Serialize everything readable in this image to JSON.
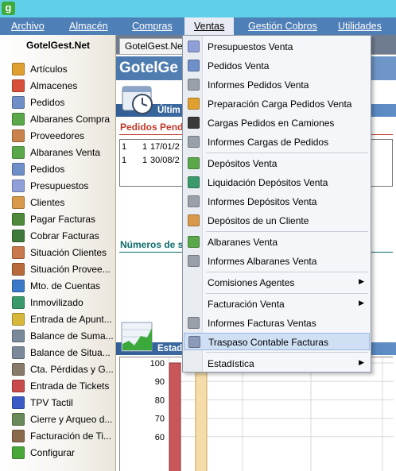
{
  "app": {
    "icon_letter": "g"
  },
  "menubar": {
    "items": [
      {
        "label": "Archivo"
      },
      {
        "label": "Almacén"
      },
      {
        "label": "Compras"
      },
      {
        "label": "Ventas"
      },
      {
        "label": "Gestión Cobros"
      },
      {
        "label": "Utilidades"
      }
    ]
  },
  "sidebar": {
    "title": "GotelGest.Net",
    "items": [
      {
        "label": "Artículos",
        "icon": "box-icon",
        "color": "#e0a030"
      },
      {
        "label": "Almacenes",
        "icon": "warehouse-icon",
        "color": "#d8503a"
      },
      {
        "label": "Pedidos",
        "icon": "document-icon",
        "color": "#6f8fc8"
      },
      {
        "label": "Albaranes Compra",
        "icon": "document-green-icon",
        "color": "#5aa84a"
      },
      {
        "label": "Proveedores",
        "icon": "person-icon",
        "color": "#c9824a"
      },
      {
        "label": "Albaranes Venta",
        "icon": "document-green-icon",
        "color": "#5aa84a"
      },
      {
        "label": "Pedidos",
        "icon": "document-icon",
        "color": "#6f8fc8"
      },
      {
        "label": "Presupuestos",
        "icon": "document-icon",
        "color": "#8f9fd8"
      },
      {
        "label": "Clientes",
        "icon": "person-icon",
        "color": "#d89a4a"
      },
      {
        "label": "Pagar Facturas",
        "icon": "money-icon",
        "color": "#4f8a3a"
      },
      {
        "label": "Cobrar Facturas",
        "icon": "money-icon",
        "color": "#3f7a3a"
      },
      {
        "label": "Situación Clientes",
        "icon": "person-icon",
        "color": "#c8784a"
      },
      {
        "label": "Situación Provee...",
        "icon": "person-icon",
        "color": "#b86a3a"
      },
      {
        "label": "Mto. de Cuentas",
        "icon": "database-icon",
        "color": "#3a7ac8"
      },
      {
        "label": "Inmovilizado",
        "icon": "globe-icon",
        "color": "#3a9a6a"
      },
      {
        "label": "Entrada de Apunt...",
        "icon": "pencil-icon",
        "color": "#d8b83a"
      },
      {
        "label": "Balance de Suma...",
        "icon": "scale-icon",
        "color": "#7a8a9a"
      },
      {
        "label": "Balance de Situa...",
        "icon": "scale-icon",
        "color": "#7a8a9a"
      },
      {
        "label": "Cta. Pérdidas y G...",
        "icon": "list-icon",
        "color": "#8a7a6a"
      },
      {
        "label": "Entrada de Tickets",
        "icon": "ticket-icon",
        "color": "#c84a4a"
      },
      {
        "label": "TPV Tactil",
        "icon": "monitor-icon",
        "color": "#3a5ac8"
      },
      {
        "label": "Cierre y Arqueo d...",
        "icon": "calculator-icon",
        "color": "#6a8a5a"
      },
      {
        "label": "Facturación de Ti...",
        "icon": "invoice-icon",
        "color": "#8a6a4a"
      },
      {
        "label": "Configurar",
        "icon": "check-icon",
        "color": "#4aa83a"
      }
    ]
  },
  "main": {
    "tab_label": "GotelGest.Net",
    "banner_text": "GotelGe",
    "ultimos_label": "Últim",
    "pedidos_title": "Pedidos Pend",
    "table_rows": [
      {
        "c1": "1",
        "c2": "1",
        "c3": "17/01/2"
      },
      {
        "c1": "1",
        "c2": "1",
        "c3": "30/08/2"
      }
    ],
    "numeros_title": "Números de s",
    "estad_label": "Estad"
  },
  "chart_data": {
    "type": "bar",
    "title": "",
    "xlabel": "",
    "ylabel": "",
    "ylim": [
      55,
      100
    ],
    "y_ticks": [
      "100",
      "90",
      "80",
      "70",
      "60"
    ],
    "series": [
      {
        "values": [
          100
        ],
        "color": "#c9575a"
      },
      {
        "values": [
          100
        ],
        "color": "#f5dca8"
      }
    ]
  },
  "dropdown": {
    "items": [
      {
        "label": "Presupuestos Venta",
        "icon": "document-icon",
        "color": "#8f9fd8",
        "submenu": false
      },
      {
        "label": "Pedidos Venta",
        "icon": "document-icon",
        "color": "#6f8fc8",
        "submenu": false
      },
      {
        "label": "Informes Pedidos Venta",
        "icon": "printer-icon",
        "color": "#9aa0aa",
        "submenu": false
      },
      {
        "label": "Preparación Carga Pedidos Venta",
        "icon": "box-icon",
        "color": "#e0a030",
        "submenu": false
      },
      {
        "label": "Cargas Pedidos en Camiones",
        "icon": "truck-icon",
        "color": "#3a3a3a",
        "submenu": false
      },
      {
        "label": "Informes Cargas de Pedidos",
        "icon": "printer-icon",
        "color": "#9aa0aa",
        "submenu": false
      },
      {
        "label": "Depósitos Venta",
        "icon": "deposit-icon",
        "color": "#5aa84a",
        "submenu": false
      },
      {
        "label": "Liquidación Depósitos Venta",
        "icon": "liquidation-icon",
        "color": "#3a9a6a",
        "submenu": false
      },
      {
        "label": "Informes Depósitos Venta",
        "icon": "printer-icon",
        "color": "#9aa0aa",
        "submenu": false
      },
      {
        "label": "Depósitos de un Cliente",
        "icon": "person-icon",
        "color": "#d89a4a",
        "submenu": false
      },
      {
        "label": "Albaranes Venta",
        "icon": "document-green-icon",
        "color": "#5aa84a",
        "submenu": false
      },
      {
        "label": "Informes Albaranes Venta",
        "icon": "printer-icon",
        "color": "#9aa0aa",
        "submenu": false
      },
      {
        "label": "Comisiones Agentes",
        "icon": "",
        "color": "",
        "submenu": true
      },
      {
        "label": "Facturación Venta",
        "icon": "",
        "color": "",
        "submenu": true
      },
      {
        "label": "Informes Facturas Ventas",
        "icon": "printer-icon",
        "color": "#9aa0aa",
        "submenu": false
      },
      {
        "label": "Traspaso Contable Facturas",
        "icon": "transfer-icon",
        "color": "#8a9ab8",
        "submenu": false
      },
      {
        "label": "Estadística",
        "icon": "",
        "color": "",
        "submenu": true
      }
    ]
  }
}
